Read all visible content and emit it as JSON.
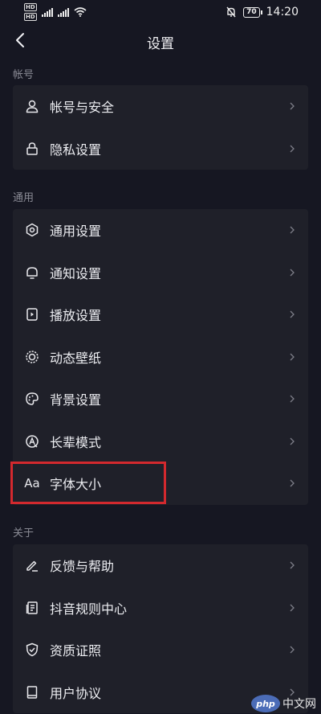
{
  "status_bar": {
    "hd1": "HD",
    "hd2": "HD",
    "time": "14:20",
    "battery": "70"
  },
  "nav": {
    "title": "设置"
  },
  "sections": [
    {
      "label": "帐号",
      "items": [
        {
          "label": "帐号与安全",
          "icon": "person-icon"
        },
        {
          "label": "隐私设置",
          "icon": "lock-icon"
        }
      ]
    },
    {
      "label": "通用",
      "items": [
        {
          "label": "通用设置",
          "icon": "gear-icon"
        },
        {
          "label": "通知设置",
          "icon": "bell-icon"
        },
        {
          "label": "播放设置",
          "icon": "play-settings-icon"
        },
        {
          "label": "动态壁纸",
          "icon": "wallpaper-icon"
        },
        {
          "label": "背景设置",
          "icon": "palette-icon"
        },
        {
          "label": "长辈模式",
          "icon": "elder-mode-icon"
        },
        {
          "label": "字体大小",
          "icon": "font-size-icon",
          "icon_text": "Aa"
        }
      ]
    },
    {
      "label": "关于",
      "items": [
        {
          "label": "反馈与帮助",
          "icon": "pencil-icon"
        },
        {
          "label": "抖音规则中心",
          "icon": "document-icon"
        },
        {
          "label": "资质证照",
          "icon": "shield-check-icon"
        },
        {
          "label": "用户协议",
          "icon": "book-icon"
        }
      ]
    }
  ],
  "highlight": {
    "color": "#d3292e"
  },
  "watermark": {
    "logo": "php",
    "text": "中文网"
  }
}
